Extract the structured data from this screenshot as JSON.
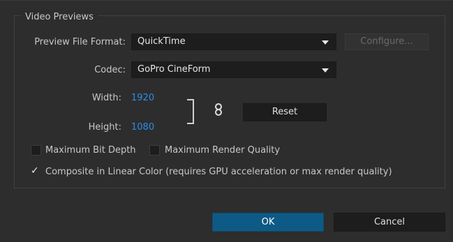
{
  "group": {
    "title": "Video Previews"
  },
  "preview_file_format": {
    "label": "Preview File Format:",
    "value": "QuickTime"
  },
  "configure_button": {
    "label": "Configure..."
  },
  "codec": {
    "label": "Codec:",
    "value": "GoPro CineForm"
  },
  "dimensions": {
    "width_label": "Width:",
    "width_value": "1920",
    "height_label": "Height:",
    "height_value": "1080",
    "link_icon": "chain-link-icon"
  },
  "reset_button": {
    "label": "Reset"
  },
  "options": [
    {
      "label": "Maximum Bit Depth",
      "checked": false
    },
    {
      "label": "Maximum Render Quality",
      "checked": false
    },
    {
      "label": "Composite in Linear Color (requires GPU acceleration or max render quality)",
      "checked": true
    }
  ],
  "footer": {
    "ok_label": "OK",
    "cancel_label": "Cancel"
  },
  "colors": {
    "accent_value": "#2d8ceb",
    "primary_button": "#0e5a86",
    "background": "#2d2d2d"
  }
}
